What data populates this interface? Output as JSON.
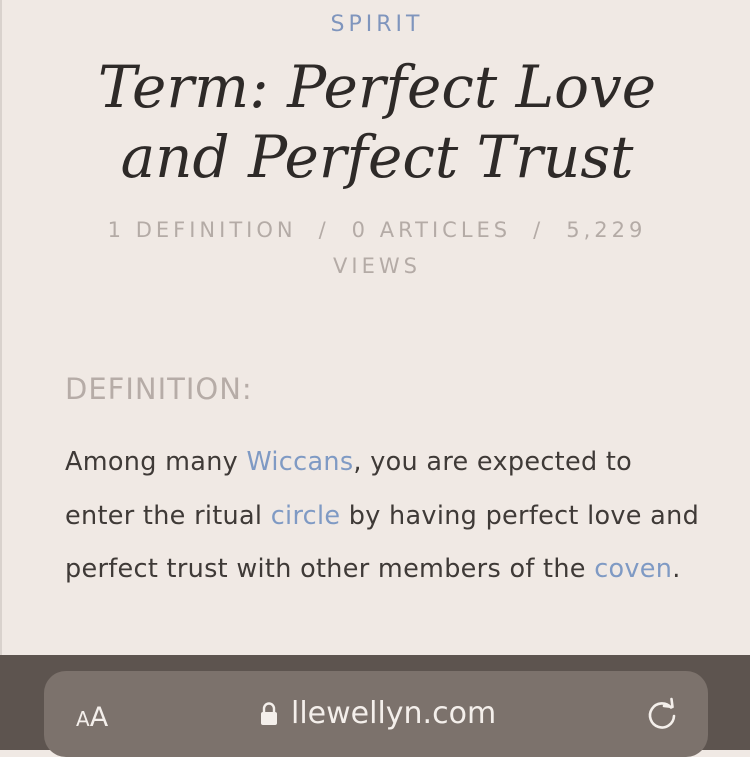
{
  "header": {
    "category": "SPIRIT",
    "title": "Term: Perfect Love and Perfect Trust"
  },
  "stats": {
    "definitions": "1 DEFINITION",
    "articles": "0 ARTICLES",
    "views": "5,229 VIEWS",
    "separator": "/"
  },
  "definition": {
    "heading": "DEFINITION:",
    "text_1": "Among many ",
    "link_wiccans": "Wiccans",
    "text_2": ", you are expected to enter the ritual ",
    "link_circle": "circle",
    "text_3": " by having perfect love and perfect trust with other members of the ",
    "link_coven": "coven",
    "text_4": "."
  },
  "browser": {
    "text_size_small": "A",
    "text_size_large": "A",
    "domain": "llewellyn.com",
    "lock_icon": "lock-icon",
    "reload_icon": "reload-icon"
  },
  "colors": {
    "background": "#f0e9e4",
    "accent": "#7f9ac4",
    "toolbar": "#5d544f",
    "urlbar": "#7c726c"
  }
}
